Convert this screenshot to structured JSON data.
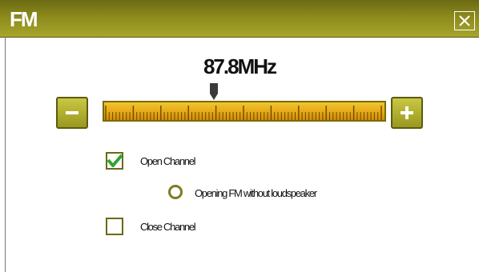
{
  "window": {
    "title": "FM",
    "close_icon": "close-icon"
  },
  "tuner": {
    "frequency_display": "87.8MHz",
    "frequency_mhz": 87.8,
    "minus_icon": "minus-icon",
    "plus_icon": "plus-icon"
  },
  "options": {
    "open_channel": {
      "label": "Open Channel",
      "checked": true
    },
    "opening_fm_without_loudspeaker": {
      "label": "Opening FM without loudspeaker",
      "selected": false
    },
    "close_channel": {
      "label": "Close Channel",
      "checked": false
    }
  },
  "colors": {
    "title_bar": "#8c8a1c",
    "scale_fill": "#e7a816",
    "check_mark": "#2fa52f",
    "border_olive": "#6a6918"
  }
}
